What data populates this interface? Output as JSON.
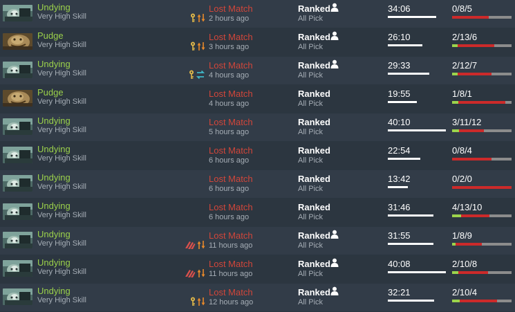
{
  "matches": [
    {
      "hero": "Undying",
      "skill": "Very High Skill",
      "result": "Lost Match",
      "time_ago": "2 hours ago",
      "lobby": "Ranked",
      "party": true,
      "mode": "All Pick",
      "duration": "34:06",
      "duration_fraction": 0.83,
      "kda": "0/8/5",
      "kills": 0,
      "deaths": 8,
      "assists": 5,
      "icons": [
        "key-icon",
        "arrows-updown-icon"
      ]
    },
    {
      "hero": "Pudge",
      "skill": "Very High Skill",
      "result": "Lost Match",
      "time_ago": "3 hours ago",
      "lobby": "Ranked",
      "party": true,
      "mode": "All Pick",
      "duration": "26:10",
      "duration_fraction": 0.59,
      "kda": "2/13/6",
      "kills": 2,
      "deaths": 13,
      "assists": 6,
      "icons": [
        "key-icon",
        "arrows-updown-icon"
      ]
    },
    {
      "hero": "Undying",
      "skill": "Very High Skill",
      "result": "Lost Match",
      "time_ago": "4 hours ago",
      "lobby": "Ranked",
      "party": true,
      "mode": "All Pick",
      "duration": "29:33",
      "duration_fraction": 0.72,
      "kda": "2/12/7",
      "kills": 2,
      "deaths": 12,
      "assists": 7,
      "icons": [
        "key-icon",
        "swap-icon"
      ]
    },
    {
      "hero": "Pudge",
      "skill": "Very High Skill",
      "result": "Lost Match",
      "time_ago": "4 hours ago",
      "lobby": "Ranked",
      "party": false,
      "mode": "All Pick",
      "duration": "19:55",
      "duration_fraction": 0.5,
      "kda": "1/8/1",
      "kills": 1,
      "deaths": 8,
      "assists": 1,
      "icons": []
    },
    {
      "hero": "Undying",
      "skill": "Very High Skill",
      "result": "Lost Match",
      "time_ago": "5 hours ago",
      "lobby": "Ranked",
      "party": false,
      "mode": "All Pick",
      "duration": "40:10",
      "duration_fraction": 1.0,
      "kda": "3/11/12",
      "kills": 3,
      "deaths": 11,
      "assists": 12,
      "icons": []
    },
    {
      "hero": "Undying",
      "skill": "Very High Skill",
      "result": "Lost Match",
      "time_ago": "6 hours ago",
      "lobby": "Ranked",
      "party": false,
      "mode": "All Pick",
      "duration": "22:54",
      "duration_fraction": 0.56,
      "kda": "0/8/4",
      "kills": 0,
      "deaths": 8,
      "assists": 4,
      "icons": []
    },
    {
      "hero": "Undying",
      "skill": "Very High Skill",
      "result": "Lost Match",
      "time_ago": "6 hours ago",
      "lobby": "Ranked",
      "party": false,
      "mode": "All Pick",
      "duration": "13:42",
      "duration_fraction": 0.34,
      "kda": "0/2/0",
      "kills": 0,
      "deaths": 2,
      "assists": 0,
      "icons": []
    },
    {
      "hero": "Undying",
      "skill": "Very High Skill",
      "result": "Lost Match",
      "time_ago": "6 hours ago",
      "lobby": "Ranked",
      "party": false,
      "mode": "All Pick",
      "duration": "31:46",
      "duration_fraction": 0.78,
      "kda": "4/13/10",
      "kills": 4,
      "deaths": 13,
      "assists": 10,
      "icons": []
    },
    {
      "hero": "Undying",
      "skill": "Very High Skill",
      "result": "Lost Match",
      "time_ago": "11 hours ago",
      "lobby": "Ranked",
      "party": true,
      "mode": "All Pick",
      "duration": "31:55",
      "duration_fraction": 0.79,
      "kda": "1/8/9",
      "kills": 1,
      "deaths": 8,
      "assists": 9,
      "icons": [
        "claw-icon",
        "arrows-updown-icon"
      ]
    },
    {
      "hero": "Undying",
      "skill": "Very High Skill",
      "result": "Lost Match",
      "time_ago": "11 hours ago",
      "lobby": "Ranked",
      "party": true,
      "mode": "All Pick",
      "duration": "40:08",
      "duration_fraction": 1.0,
      "kda": "2/10/8",
      "kills": 2,
      "deaths": 10,
      "assists": 8,
      "icons": [
        "claw-icon",
        "arrows-updown-icon"
      ]
    },
    {
      "hero": "Undying",
      "skill": "Very High Skill",
      "result": "Lost Match",
      "time_ago": "12 hours ago",
      "lobby": "Ranked",
      "party": true,
      "mode": "All Pick",
      "duration": "32:21",
      "duration_fraction": 0.8,
      "kda": "2/10/4",
      "kills": 2,
      "deaths": 10,
      "assists": 4,
      "icons": [
        "key-icon",
        "arrows-updown-icon"
      ]
    }
  ],
  "colors": {
    "hero_name": "#9bd14b",
    "lost": "#d2463a",
    "kills": "#9cd44c",
    "deaths": "#cc2a2a",
    "assists": "#8c8c8c"
  }
}
